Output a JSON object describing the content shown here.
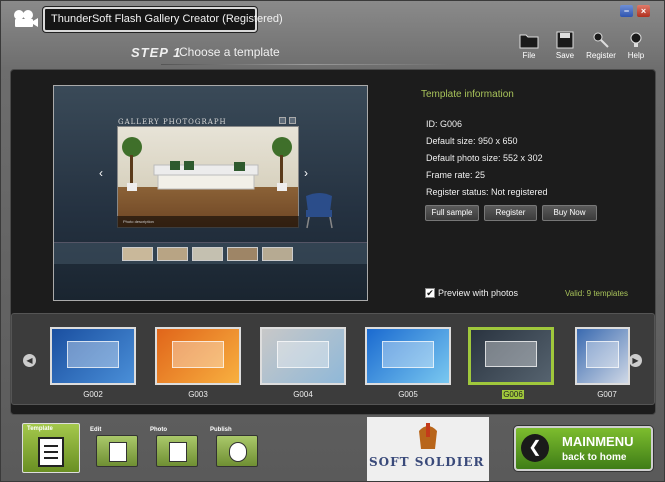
{
  "window": {
    "title": "ThunderSoft Flash Gallery Creator (Registered)",
    "minimize_glyph": "−",
    "close_glyph": "×"
  },
  "step": {
    "label": "STEP 1",
    "title": "Choose a template"
  },
  "toolbar": [
    {
      "label": "File",
      "icon": "folder-icon"
    },
    {
      "label": "Save",
      "icon": "save-icon"
    },
    {
      "label": "Register",
      "icon": "key-icon"
    },
    {
      "label": "Help",
      "icon": "lightbulb-icon"
    }
  ],
  "preview": {
    "gallery_title": "GALLERY PHOTOGRAPH",
    "photo_description": "Photo description"
  },
  "template_info": {
    "heading": "Template information",
    "id": "ID: G006",
    "default_size": "Default size: 950 x 650",
    "default_photo_size": "Default photo size: 552 x 302",
    "frame_rate": "Frame rate: 25",
    "register_status": "Register status: Not registered",
    "buttons": {
      "full_sample": "Full sample",
      "register": "Register",
      "buy_now": "Buy Now"
    },
    "preview_with_photos": "Preview with photos",
    "preview_checked": true,
    "valid_text": "Valid: 9 templates"
  },
  "templates": [
    {
      "id": "G002",
      "selected": false,
      "colors": [
        "#1a4fa0",
        "#4a8fd8"
      ]
    },
    {
      "id": "G003",
      "selected": false,
      "colors": [
        "#e0651a",
        "#f8b040"
      ]
    },
    {
      "id": "G004",
      "selected": false,
      "colors": [
        "#c8c8c8",
        "#8fb8d8"
      ]
    },
    {
      "id": "G005",
      "selected": false,
      "colors": [
        "#1a6ad0",
        "#7ac8f0"
      ]
    },
    {
      "id": "G006",
      "selected": true,
      "colors": [
        "#2a3440",
        "#56636f"
      ]
    },
    {
      "id": "G007",
      "selected": false,
      "colors": [
        "#3a6ab0",
        "#cfd8e6"
      ]
    }
  ],
  "bottom_tabs": [
    {
      "label": "Template",
      "active": true
    },
    {
      "label": "Edit",
      "active": false
    },
    {
      "label": "Photo",
      "active": false
    },
    {
      "label": "Publish",
      "active": false
    }
  ],
  "watermark": {
    "text": "SOFT SOLDIER"
  },
  "main_menu": {
    "title": "MAINMENU",
    "subtitle": "back to home",
    "arrow_glyph": "❮"
  },
  "colors": {
    "accent_green": "#a0c83c",
    "info_green": "#a8c35a"
  }
}
